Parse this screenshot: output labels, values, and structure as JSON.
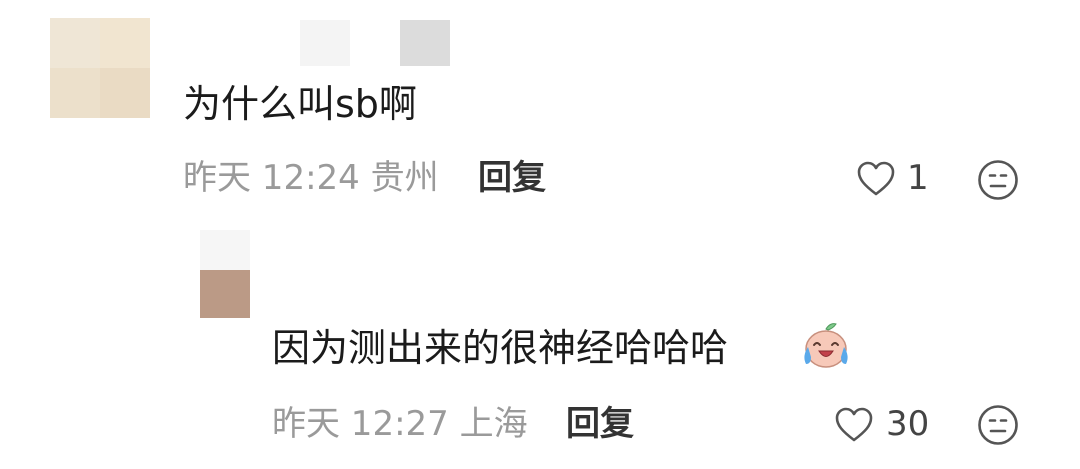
{
  "comments": [
    {
      "text": "为什么叫sb啊",
      "time": "昨天 12:24",
      "location": "贵州",
      "reply_label": "回复",
      "likes": "1"
    },
    {
      "text": "因为测出来的很神经哈哈哈",
      "emoji": "crying-laughing-peach",
      "time": "昨天 12:27",
      "location": "上海",
      "reply_label": "回复",
      "likes": "30"
    }
  ],
  "icons": {
    "like": "heart-outline-icon",
    "dislike": "neutral-face-icon"
  },
  "colors": {
    "meta_text": "#9a9a9a",
    "reply_text": "#333333",
    "icon_stroke": "#555555"
  }
}
